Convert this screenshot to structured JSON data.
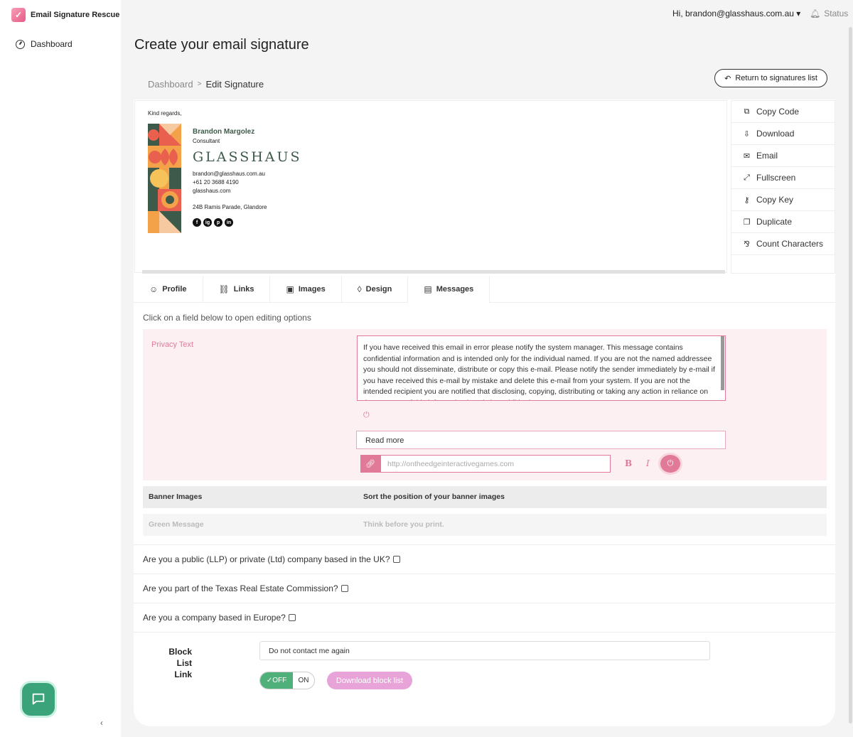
{
  "app": {
    "name": "Email Signature Rescue",
    "logo_icon": "heart-check-icon"
  },
  "sidebar": {
    "items": [
      {
        "label": "Dashboard",
        "icon": "gauge-icon"
      }
    ],
    "collapse_glyph": "‹"
  },
  "topbar": {
    "user": "Hi, brandon@glasshaus.com.au ▾",
    "status": "Status"
  },
  "page": {
    "title": "Create your email signature",
    "breadcrumb": {
      "parent": "Dashboard",
      "sep": ">",
      "current": "Edit Signature"
    },
    "return_button": "Return to signatures list"
  },
  "signature": {
    "greeting": "Kind regards,",
    "name": "Brandon Margolez",
    "role": "Consultant",
    "company": "GLASSHAUS",
    "email": "brandon@glasshaus.com.au",
    "phone": "+61 20 3688 4190",
    "website": "glasshaus.com",
    "address": "24B Ramis Parade, Glandore",
    "social": [
      "f",
      "ig",
      "p",
      "in"
    ]
  },
  "actions": [
    {
      "label": "Copy Code",
      "icon": "⧉"
    },
    {
      "label": "Download",
      "icon": "⇩"
    },
    {
      "label": "Email",
      "icon": "✉"
    },
    {
      "label": "Fullscreen",
      "icon": "⤢"
    },
    {
      "label": "Copy Key",
      "icon": "⚷"
    },
    {
      "label": "Duplicate",
      "icon": "❐"
    },
    {
      "label": "Count Characters",
      "icon": "⅋"
    }
  ],
  "tabs": [
    {
      "label": "Profile",
      "icon": "☺"
    },
    {
      "label": "Links",
      "icon": "⛓"
    },
    {
      "label": "Images",
      "icon": "▣"
    },
    {
      "label": "Design",
      "icon": "◊"
    },
    {
      "label": "Messages",
      "icon": "▤"
    }
  ],
  "messages": {
    "hint": "Click on a field below to open editing options",
    "privacy_label": "Privacy Text",
    "privacy_text": "If you have received this email in error please notify the system manager. This message contains confidential information and is intended only for the individual named. If you are not the named addressee you should not disseminate, distribute or copy this e-mail. Please notify the sender immediately by e-mail if you have received this e-mail by mistake and delete this e-mail from your system. If you are not the intended recipient you are notified that disclosing, copying, distributing or taking any action in reliance on the contents of this information is strictly prohibited.",
    "read_more": "Read more",
    "link_placeholder": "http://ontheedgeinteractivegames.com",
    "bold": "B",
    "italic": "I",
    "banner_label": "Banner Images",
    "banner_value": "Sort the position of your banner images",
    "green_label": "Green Message",
    "green_value": "Think before you print."
  },
  "questions": [
    "Are you a public (LLP) or private (Ltd) company based in the UK?",
    "Are you part of the Texas Real Estate Commission?",
    "Are you a company based in Europe?"
  ],
  "block_list": {
    "label_line1": "Block List",
    "label_line2": "Link",
    "value": "Do not contact me again",
    "toggle_off": "✓OFF",
    "toggle_on": "ON",
    "download": "Download block list"
  },
  "colors": {
    "accent": "#e07a98",
    "green": "#3aa37a",
    "brand_dark": "#3e5a4a"
  }
}
